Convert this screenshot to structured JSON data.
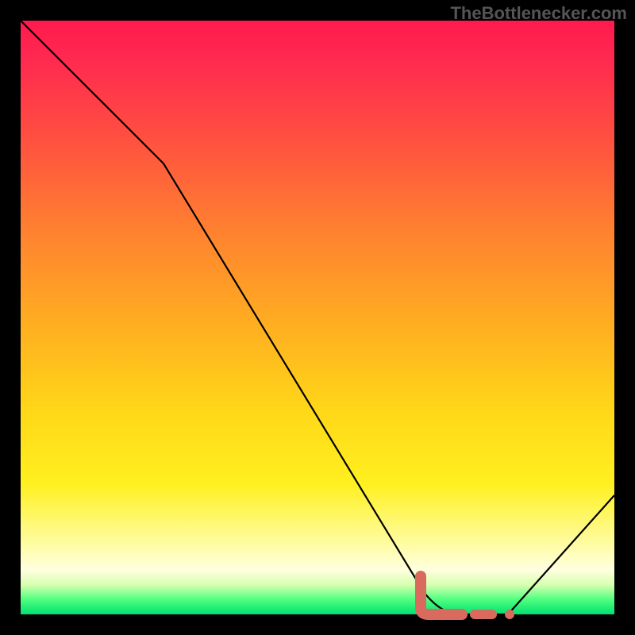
{
  "watermark": "TheBottlenecker.com",
  "chart_data": {
    "type": "line",
    "title": "",
    "xlabel": "",
    "ylabel": "",
    "xlim": [
      0,
      100
    ],
    "ylim": [
      0,
      100
    ],
    "series": [
      {
        "name": "curve",
        "color": "#000000",
        "x": [
          0,
          24,
          68,
          74,
          82,
          100
        ],
        "values": [
          100,
          76,
          4,
          0,
          0,
          20
        ]
      }
    ],
    "highlight_segments": [
      {
        "shape": "L-blob",
        "color": "#d96a5e",
        "x_range": [
          68,
          74
        ],
        "y_range": [
          0,
          4
        ]
      },
      {
        "shape": "dash",
        "color": "#d96a5e",
        "x_range": [
          76,
          79
        ],
        "y_range": [
          0,
          0
        ]
      },
      {
        "shape": "dot",
        "color": "#d96a5e",
        "x": 82,
        "y": 0
      }
    ],
    "gradient_stops": [
      {
        "pos": 0.0,
        "color": "#ff1a4d"
      },
      {
        "pos": 0.2,
        "color": "#ff5040"
      },
      {
        "pos": 0.52,
        "color": "#ffb020"
      },
      {
        "pos": 0.78,
        "color": "#fff020"
      },
      {
        "pos": 0.95,
        "color": "#d8ffb0"
      },
      {
        "pos": 1.0,
        "color": "#00e070"
      }
    ]
  }
}
